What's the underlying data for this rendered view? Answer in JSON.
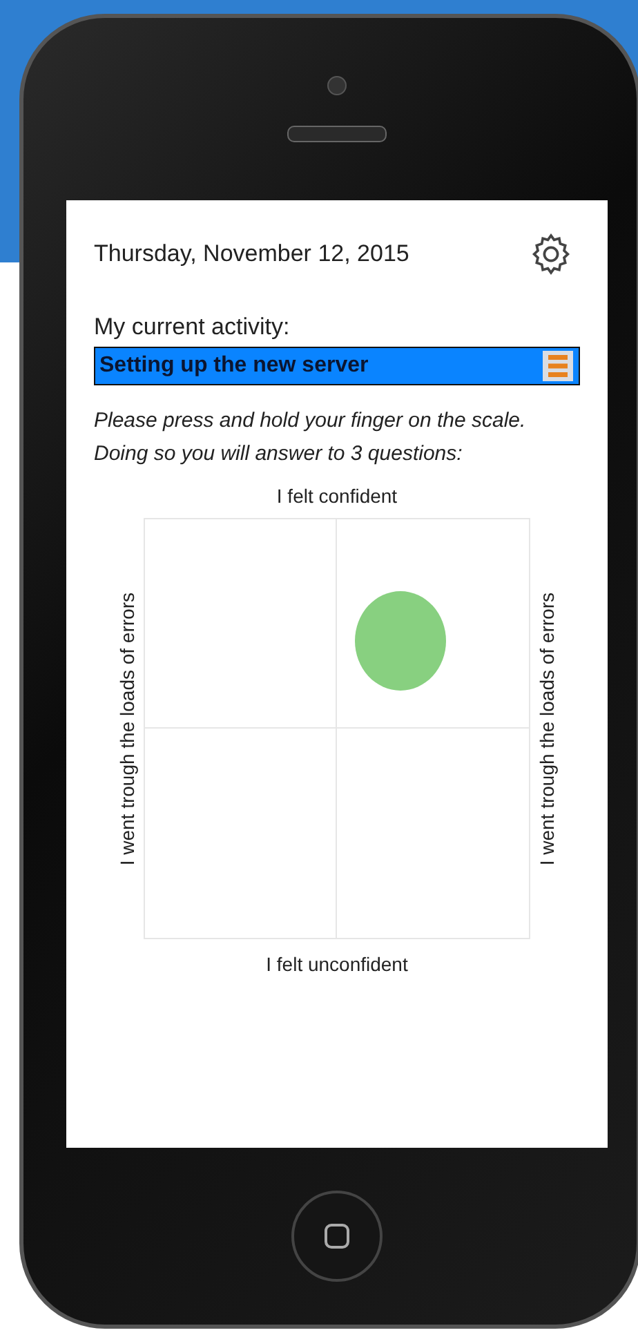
{
  "screen": {
    "date": "Thursday, November 12, 2015",
    "activity_label": "My current activity:",
    "activity": {
      "value": "Setting up the new server"
    },
    "instructions": "Please press and hold your finger on the scale. Doing so you will answer to 3 questions:",
    "scale": {
      "top_label": "I felt confident",
      "bottom_label": "I felt unconfident",
      "left_label": "I went trough the loads of errors",
      "right_label": "I went trough the loads of errors"
    }
  }
}
